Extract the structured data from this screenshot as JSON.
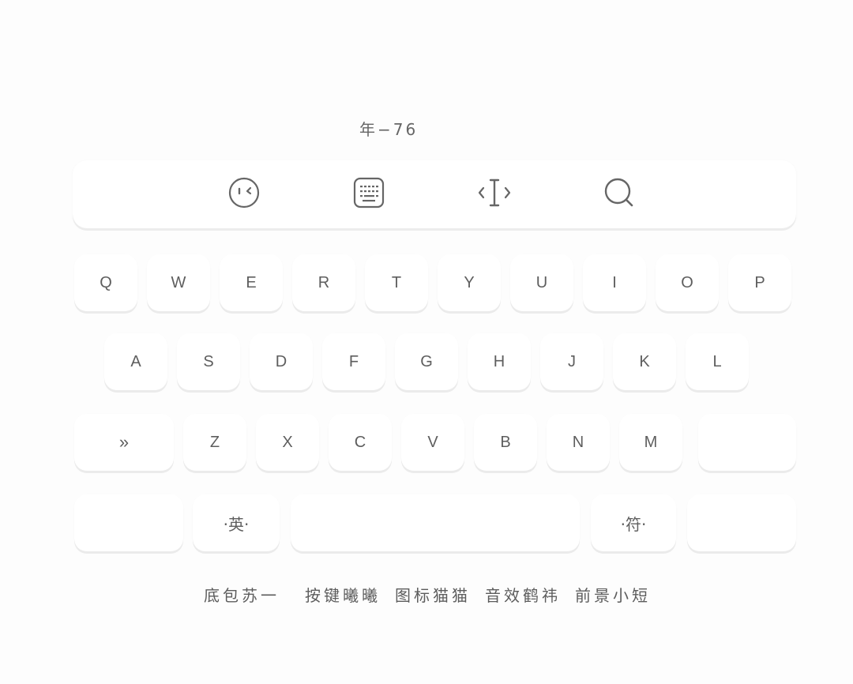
{
  "header": {
    "label": "年−76"
  },
  "toolbar": {
    "icons": [
      "emoji-face-icon",
      "keyboard-icon",
      "cursor-move-icon",
      "search-icon"
    ]
  },
  "keyboard": {
    "row1": [
      "Q",
      "W",
      "E",
      "R",
      "T",
      "Y",
      "U",
      "I",
      "O",
      "P"
    ],
    "row2": [
      "A",
      "S",
      "D",
      "F",
      "G",
      "H",
      "J",
      "K",
      "L"
    ],
    "row3": {
      "shift": "»",
      "letters": [
        "Z",
        "X",
        "C",
        "V",
        "B",
        "N",
        "M"
      ],
      "backspace": ""
    },
    "row4": {
      "num": "",
      "lang": "·英·",
      "space": "",
      "symbols": "·符·",
      "enter": ""
    }
  },
  "footer": {
    "items": [
      "底包苏一",
      "按键曦曦",
      "图标猫猫",
      "音效鹤祎",
      "前景小短"
    ]
  },
  "colors": {
    "background": "#fdfdfd",
    "key": "#ffffff",
    "text": "#5e5e5e",
    "key_shadow": "#ebebeb"
  }
}
